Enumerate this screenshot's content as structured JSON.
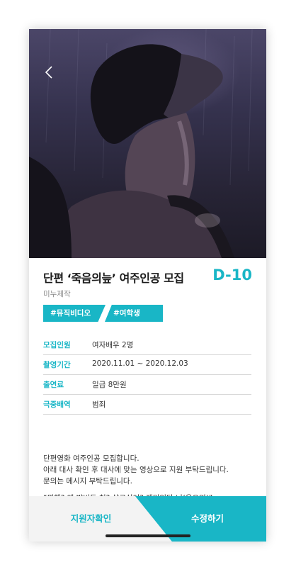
{
  "header": {
    "back_icon": "chevron-left-icon"
  },
  "post": {
    "title": "단편 ‘죽음의늪’ 여주인공 모집",
    "dday": "D-10",
    "producer": "미누제작",
    "tags": [
      "#뮤직비디오",
      "#여학생"
    ]
  },
  "info": [
    {
      "label": "모집인원",
      "value": "여자배우 2명"
    },
    {
      "label": "촬영기간",
      "value": "2020.11.01 ~ 2020.12.03"
    },
    {
      "label": "출연료",
      "value": "일급 8만원"
    },
    {
      "label": "극중배역",
      "value": "범죄"
    }
  ],
  "description": [
    "단편영화 여주인공 모집합니다.",
    "아래 대사 확인 후 대사에 맞는 영상으로 지원 부탁드립니다.",
    "문의는 메시지 부탁드립니다."
  ],
  "quote": "“뭐해? 왜 발버둥 쳐? 살고싶어? 재미있다 너(웃으며)”",
  "actions": {
    "left": "지원자확인",
    "right": "수정하기"
  },
  "colors": {
    "accent": "#19b6c6"
  }
}
